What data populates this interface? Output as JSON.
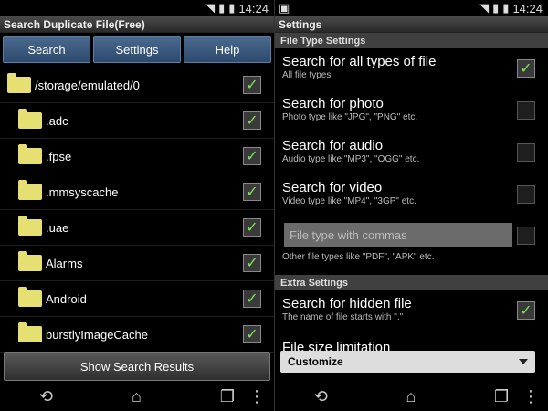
{
  "status": {
    "time": "14:24"
  },
  "left": {
    "title": "Search Duplicate File(Free)",
    "tabs": [
      "Search",
      "Settings",
      "Help"
    ],
    "root_path": "/storage/emulated/0",
    "folders": [
      ".adc",
      ".fpse",
      ".mmsyscache",
      ".uae",
      "Alarms",
      "Android",
      "burstlyImageCache"
    ],
    "show_results_label": "Show Search Results"
  },
  "right": {
    "title": "Settings",
    "file_type_header": "File Type Settings",
    "settings": [
      {
        "title": "Search for all types of file",
        "subtitle": "All file types",
        "checked": true
      },
      {
        "title": "Search for photo",
        "subtitle": "Photo type like \"JPG\", \"PNG\" etc.",
        "checked": false
      },
      {
        "title": "Search for audio",
        "subtitle": "Audio type like \"MP3\", \"OGG\" etc.",
        "checked": false
      },
      {
        "title": "Search for video",
        "subtitle": "Video type like \"MP4\", \"3GP\" etc.",
        "checked": false
      }
    ],
    "custom_types_placeholder": "File type with commas",
    "other_types_hint": "Other file types like \"PDF\", \"APK\" etc.",
    "extra_header": "Extra Settings",
    "hidden": {
      "title": "Search for hidden file",
      "subtitle": "The name of file starts with \".\"",
      "checked": true
    },
    "size_label": "File size limitation",
    "size_select_value": "Customize"
  },
  "icons": {
    "check": "✓",
    "back": "back-icon",
    "home": "home-icon",
    "recent": "recent-apps-icon",
    "menu": "overflow-menu-icon"
  }
}
